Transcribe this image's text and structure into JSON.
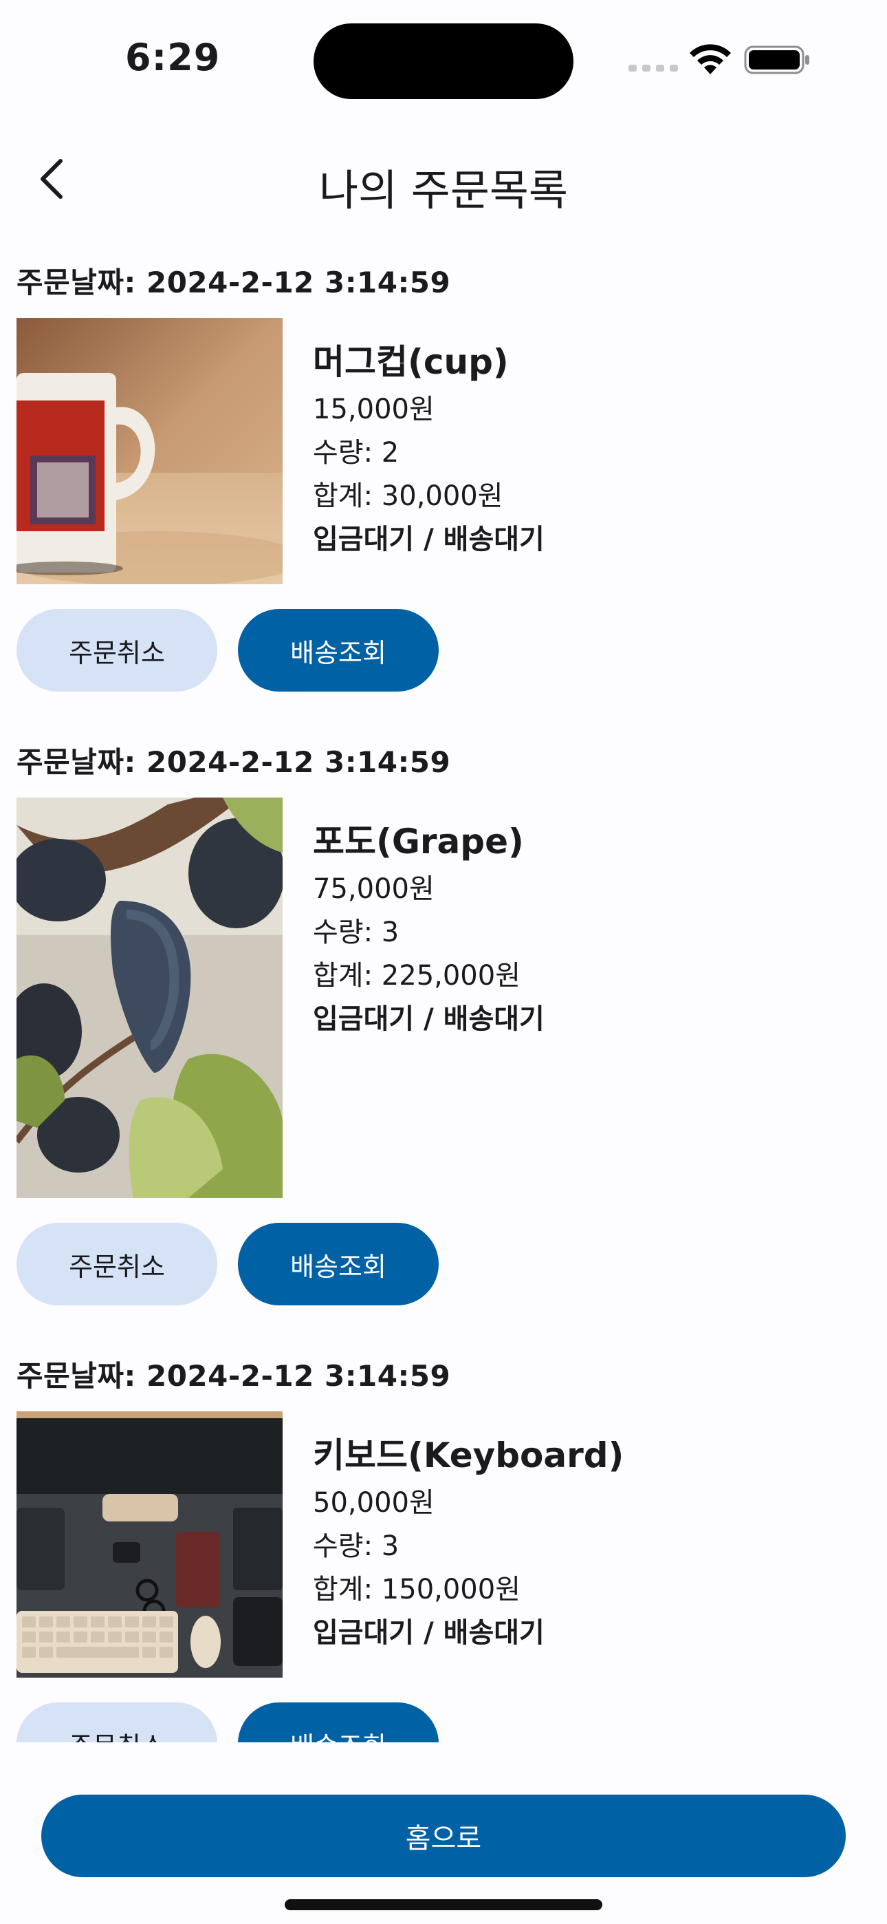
{
  "status_bar": {
    "time": "6:29"
  },
  "header": {
    "title": "나의 주문목록",
    "back_icon": "chevron-left-icon"
  },
  "orders": [
    {
      "date_label": "주문날짜: 2024-2-12 3:14:59",
      "product_name": "머그컵(cup)",
      "price": "15,000원",
      "quantity": "수량: 2",
      "total": "합계: 30,000원",
      "status": "입금대기 / 배송대기",
      "cancel_label": "주문취소",
      "track_label": "배송조회"
    },
    {
      "date_label": "주문날짜: 2024-2-12 3:14:59",
      "product_name": "포도(Grape)",
      "price": "75,000원",
      "quantity": "수량: 3",
      "total": "합계: 225,000원",
      "status": "입금대기 / 배송대기",
      "cancel_label": "주문취소",
      "track_label": "배송조회"
    },
    {
      "date_label": "주문날짜: 2024-2-12 3:14:59",
      "product_name": "키보드(Keyboard)",
      "price": "50,000원",
      "quantity": "수량: 3",
      "total": "합계: 150,000원",
      "status": "입금대기 / 배송대기",
      "cancel_label": "주문취소",
      "track_label": "배송조회"
    }
  ],
  "footer": {
    "home_label": "홈으로"
  },
  "colors": {
    "primary": "#0061a4",
    "secondary_container": "#d6e3f7",
    "background": "#fdfcff"
  }
}
